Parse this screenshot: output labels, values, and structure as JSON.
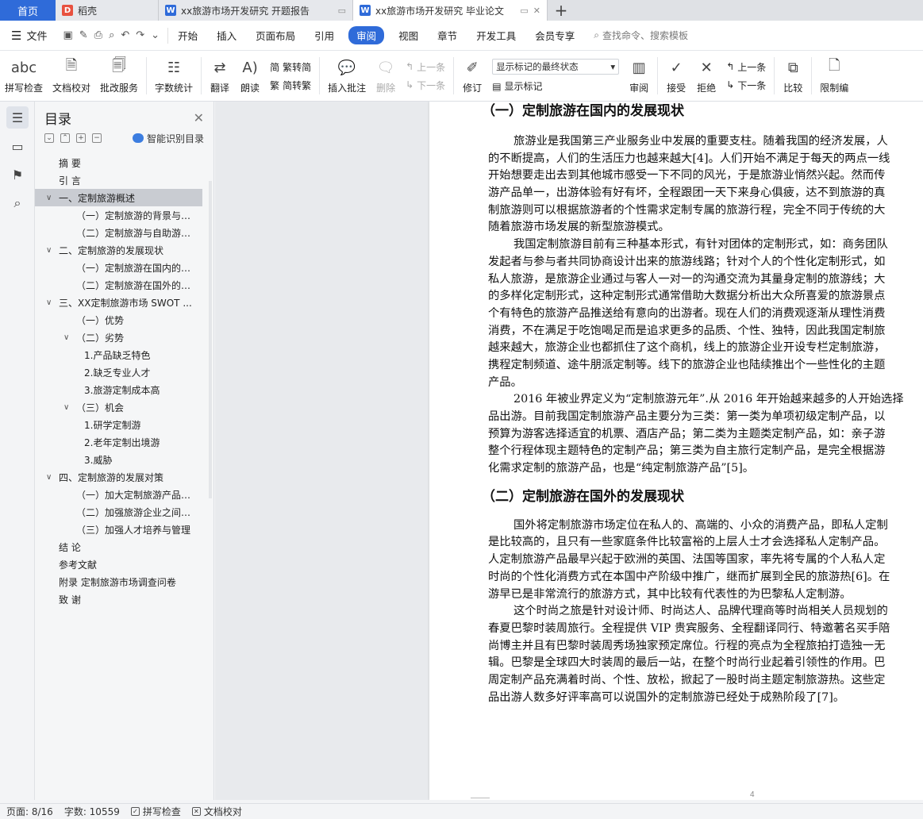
{
  "tabs": {
    "home": "首页",
    "items": [
      {
        "label": "稻壳",
        "icon": "daoke-icon"
      },
      {
        "label": "xx旅游市场开发研究 开题报告",
        "icon": "wps-writer-icon"
      },
      {
        "label": "xx旅游市场开发研究 毕业论文",
        "icon": "wps-writer-icon",
        "active": true
      }
    ],
    "new_tab": "+"
  },
  "menubar": {
    "file": "文件",
    "tabs": [
      "开始",
      "插入",
      "页面布局",
      "引用",
      "审阅",
      "视图",
      "章节",
      "开发工具",
      "会员专享"
    ],
    "active_tab": "审阅",
    "search": "查找命令、搜索模板"
  },
  "ribbon": {
    "spell_check": "拼写检查",
    "doc_proof": "文档校对",
    "batch_service": "批改服务",
    "word_count": "字数统计",
    "translate": "翻译",
    "read_aloud": "朗读",
    "trad_to_simp": "繁转简",
    "simp_to_trad": "简转繁",
    "insert_comment": "插入批注",
    "delete": "删除",
    "prev_comment": "上一条",
    "next_comment": "下一条",
    "revise": "修订",
    "markup_select": "显示标记的最终状态",
    "show_markup": "显示标记",
    "review": "审阅",
    "accept": "接受",
    "reject": "拒绝",
    "prev_change": "上一条",
    "next_change": "下一条",
    "compare": "比较",
    "restrict": "限制编"
  },
  "toc": {
    "title": "目录",
    "smart_label": "智能识别目录",
    "items": [
      {
        "text": "摘    要",
        "level": 1,
        "caret": ""
      },
      {
        "text": "引    言",
        "level": 1,
        "caret": ""
      },
      {
        "text": "一、定制旅游概述",
        "level": 1,
        "caret": "v",
        "selected": true
      },
      {
        "text": "（一）定制旅游的背景与概...",
        "level": 2,
        "caret": ""
      },
      {
        "text": "（二）定制旅游与自助游的...",
        "level": 2,
        "caret": ""
      },
      {
        "text": "二、定制旅游的发展现状",
        "level": 1,
        "caret": "v"
      },
      {
        "text": "（一）定制旅游在国内的发...",
        "level": 2,
        "caret": ""
      },
      {
        "text": "（二）定制旅游在国外的发...",
        "level": 2,
        "caret": ""
      },
      {
        "text": "三、XX定制旅游市场 SWOT ...",
        "level": 1,
        "caret": "v"
      },
      {
        "text": "（一）优势",
        "level": 2,
        "caret": ""
      },
      {
        "text": "（二）劣势",
        "level": 2,
        "caret": "v"
      },
      {
        "text": "1.产品缺乏特色",
        "level": 3,
        "caret": ""
      },
      {
        "text": "2.缺乏专业人才",
        "level": 3,
        "caret": ""
      },
      {
        "text": "3.旅游定制成本高",
        "level": 3,
        "caret": ""
      },
      {
        "text": "（三）机会",
        "level": 2,
        "caret": "v"
      },
      {
        "text": "1.研学定制游",
        "level": 3,
        "caret": ""
      },
      {
        "text": "2.老年定制出境游",
        "level": 3,
        "caret": ""
      },
      {
        "text": "3.威胁",
        "level": 3,
        "caret": ""
      },
      {
        "text": "四、定制旅游的发展对策",
        "level": 1,
        "caret": "v"
      },
      {
        "text": "（一）加大定制旅游产品内...",
        "level": 2,
        "caret": ""
      },
      {
        "text": "（二）加强旅游企业之间合...",
        "level": 2,
        "caret": ""
      },
      {
        "text": "（三）加强人才培养与管理",
        "level": 2,
        "caret": ""
      },
      {
        "text": "结    论",
        "level": 1,
        "caret": ""
      },
      {
        "text": "参考文献",
        "level": 1,
        "caret": ""
      },
      {
        "text": "附录    定制旅游市场调查问卷",
        "level": 1,
        "caret": ""
      },
      {
        "text": "致    谢",
        "level": 1,
        "caret": ""
      }
    ]
  },
  "document": {
    "heading1": "（一）定制旅游在国内的发展现状",
    "para1": [
      "旅游业是我国第三产业服务业中发展的重要支柱。随着我国的经济发展，人",
      "的不断提高，人们的生活压力也越来越大[4]。人们开始不满足于每天的两点一线",
      "开始想要走出去到其他城市感受一下不同的风光，于是旅游业悄然兴起。然而传",
      "游产品单一，出游体验有好有坏，全程跟团一天下来身心俱疲，达不到旅游的真",
      "制旅游则可以根据旅游者的个性需求定制专属的旅游行程，完全不同于传统的大",
      "随着旅游市场发展的新型旅游模式。"
    ],
    "para2": [
      "我国定制旅游目前有三种基本形式，有针对团体的定制形式，如：商务团队",
      "发起者与参与者共同协商设计出来的旅游线路；针对个人的个性化定制形式，如",
      "私人旅游，是旅游企业通过与客人一对一的沟通交流为其量身定制的旅游线；大",
      "的多样化定制形式，这种定制形式通常借助大数据分析出大众所喜爱的旅游景点",
      "个有特色的旅游产品推送给有意向的出游者。现在人们的消费观逐渐从理性消费",
      "消费，不在满足于吃饱喝足而是追求更多的品质、个性、独特，因此我国定制旅",
      "越来越大，旅游企业也都抓住了这个商机，线上的旅游企业开设专栏定制旅游，",
      "携程定制频道、途牛朋派定制等。线下的旅游企业也陆续推出个一些性化的主题",
      "产品。"
    ],
    "para3": [
      "2016 年被业界定义为“定制旅游元年”.从 2016 年开始越来越多的人开始选择",
      "品出游。目前我国定制旅游产品主要分为三类：第一类为单项初级定制产品，以",
      "预算为游客选择适宜的机票、酒店产品；第二类为主题类定制产品，如：亲子游",
      "整个行程体现主题特色的定制产品；第三类为自主旅行定制产品，是完全根据游",
      "化需求定制的旅游产品，也是“纯定制旅游产品”[5]。"
    ],
    "heading2": "（二）定制旅游在国外的发展现状",
    "para4": [
      "国外将定制旅游市场定位在私人的、高端的、小众的消费产品，即私人定制",
      "是比较高的，且只有一些家庭条件比较富裕的上层人士才会选择私人定制产品。",
      "人定制旅游产品最早兴起于欧洲的英国、法国等国家，率先将专属的个人私人定",
      "时尚的个性化消费方式在本国中产阶级中推广，继而扩展到全民的旅游热[6]。在",
      "游早已是非常流行的旅游方式，其中比较有代表性的为巴黎私人定制游。"
    ],
    "para5": [
      "这个时尚之旅是针对设计师、时尚达人、品牌代理商等时尚相关人员规划的",
      "春夏巴黎时装周旅行。全程提供 VIP 贵宾服务、全程翻译同行、特邀著名买手陪",
      "尚博主并且有巴黎时装周秀场独家预定席位。行程的亮点为全程旅拍打造独一无",
      "辑。巴黎是全球四大时装周的最后一站，在整个时尚行业起着引领性的作用。巴",
      "周定制产品充满着时尚、个性、放松，掀起了一股时尚主题定制旅游热。这些定",
      "品出游人数多好评率高可以说国外的定制旅游已经处于成熟阶段了[7]。"
    ],
    "page_number": "4"
  },
  "statusbar": {
    "page": "页面: 8/16",
    "words": "字数: 10559",
    "spell": "拼写检查",
    "proof": "文档校对"
  }
}
